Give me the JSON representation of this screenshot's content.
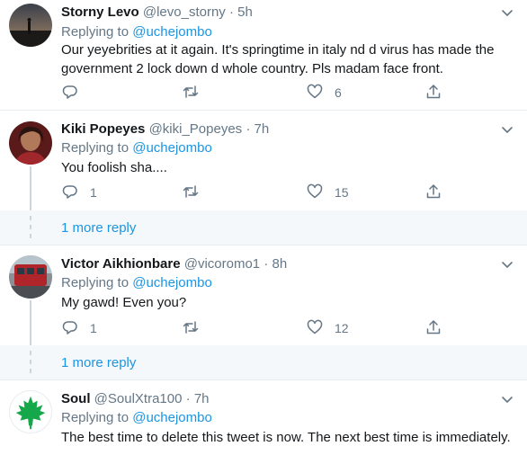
{
  "colors": {
    "accent": "#1b95e0",
    "muted": "#657786",
    "border": "#e6ecf0",
    "moreBg": "#f5f8fa"
  },
  "tweets": [
    {
      "name": "Storny Levo",
      "handle": "@levo_storny",
      "dot": "·",
      "time": "5h",
      "replying_prefix": "Replying to",
      "replying_handle": "@uchejombo",
      "text": "Our yeyebrities at it again. It's springtime in italy nd d virus has made the government 2 lock down d whole country. Pls madam face front.",
      "replies": "",
      "retweets": "",
      "likes": "6",
      "icons": [
        "reply-icon",
        "retweet-icon",
        "like-icon",
        "share-icon"
      ]
    },
    {
      "name": "Kiki Popeyes",
      "handle": "@kiki_Popeyes",
      "dot": "·",
      "time": "7h",
      "replying_prefix": "Replying to",
      "replying_handle": "@uchejombo",
      "text": "You foolish sha....",
      "replies": "1",
      "retweets": "",
      "likes": "15",
      "more_replies": "1 more reply"
    },
    {
      "name": "Victor Aikhionbare",
      "handle": "@vicoromo1",
      "dot": "·",
      "time": "8h",
      "replying_prefix": "Replying to",
      "replying_handle": "@uchejombo",
      "text": "My gawd! Even you?",
      "replies": "1",
      "retweets": "",
      "likes": "12",
      "more_replies": "1 more reply"
    },
    {
      "name": "Soul",
      "handle": "@SoulXtra100",
      "dot": "·",
      "time": "7h",
      "replying_prefix": "Replying to",
      "replying_handle": "@uchejombo",
      "text": "The best time to delete this tweet is now. The next best time is immediately."
    }
  ]
}
